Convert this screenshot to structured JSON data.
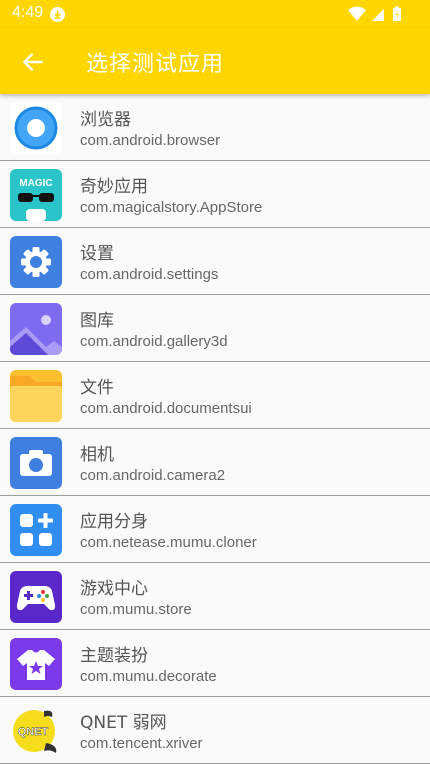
{
  "status_bar": {
    "time": "4:49",
    "icons": [
      "download-icon",
      "wifi-icon",
      "signal-icon",
      "battery-icon"
    ]
  },
  "app_bar": {
    "title": "选择测试应用",
    "back_icon": "arrow-back-icon",
    "color": "#ffd600"
  },
  "apps": [
    {
      "name": "浏览器",
      "package": "com.android.browser",
      "icon": "browser-icon"
    },
    {
      "name": "奇妙应用",
      "package": "com.magicalstory.AppStore",
      "icon": "magic-icon",
      "icon_text": "MAGIC"
    },
    {
      "name": "设置",
      "package": "com.android.settings",
      "icon": "settings-icon"
    },
    {
      "name": "图库",
      "package": "com.android.gallery3d",
      "icon": "gallery-icon"
    },
    {
      "name": "文件",
      "package": "com.android.documentsui",
      "icon": "folder-icon"
    },
    {
      "name": "相机",
      "package": "com.android.camera2",
      "icon": "camera-icon"
    },
    {
      "name": "应用分身",
      "package": "com.netease.mumu.cloner",
      "icon": "cloner-icon"
    },
    {
      "name": "游戏中心",
      "package": "com.mumu.store",
      "icon": "gamepad-icon"
    },
    {
      "name": "主题装扮",
      "package": "com.mumu.decorate",
      "icon": "theme-shirt-icon"
    },
    {
      "name": "QNET 弱网",
      "package": "com.tencent.xriver",
      "icon": "qnet-icon",
      "icon_text": "QNET"
    }
  ]
}
